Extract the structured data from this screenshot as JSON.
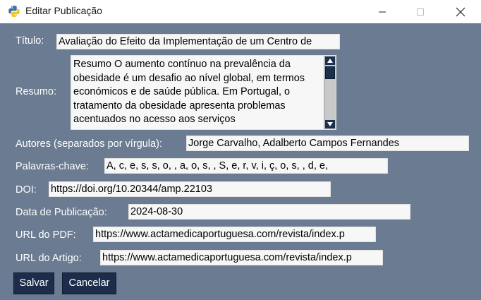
{
  "window": {
    "title": "Editar Publicação",
    "app_icon": "python-icon",
    "controls": [
      "minimize-icon",
      "maximize-icon",
      "close-icon"
    ]
  },
  "form": {
    "titulo": {
      "label": "Título:",
      "value": "Avaliação do Efeito da Implementação de um Centro de"
    },
    "resumo": {
      "label": "Resumo:",
      "value": "Resumo O aumento contínuo na prevalência da obesidade é um desafio ao nível global, em termos económicos e de saúde pública. Em Portugal, o tratamento da obesidade apresenta problemas acentuados no acesso aos serviços"
    },
    "autores": {
      "label": "Autores (separados por vírgula):",
      "value": "Jorge Carvalho, Adalberto Campos Fernandes"
    },
    "palavras": {
      "label": "Palavras-chave:",
      "value": "A, c, e, s, s, o,  , a, o, s,  , S, e, r, v, i, ç, o, s,  , d, e,"
    },
    "doi": {
      "label": "DOI:",
      "value": "https://doi.org/10.20344/amp.22103"
    },
    "data": {
      "label": "Data de Publicação:",
      "value": "2024-08-30"
    },
    "url_pdf": {
      "label": "URL do PDF:",
      "value": "https://www.actamedicaportuguesa.com/revista/index.p"
    },
    "url_artigo": {
      "label": "URL do Artigo:",
      "value": "https://www.actamedicaportuguesa.com/revista/index.p"
    }
  },
  "buttons": {
    "save": "Salvar",
    "cancel": "Cancelar"
  },
  "colors": {
    "background": "#6b7b91",
    "button": "#1c2c4a",
    "field": "#f7f7f7"
  }
}
